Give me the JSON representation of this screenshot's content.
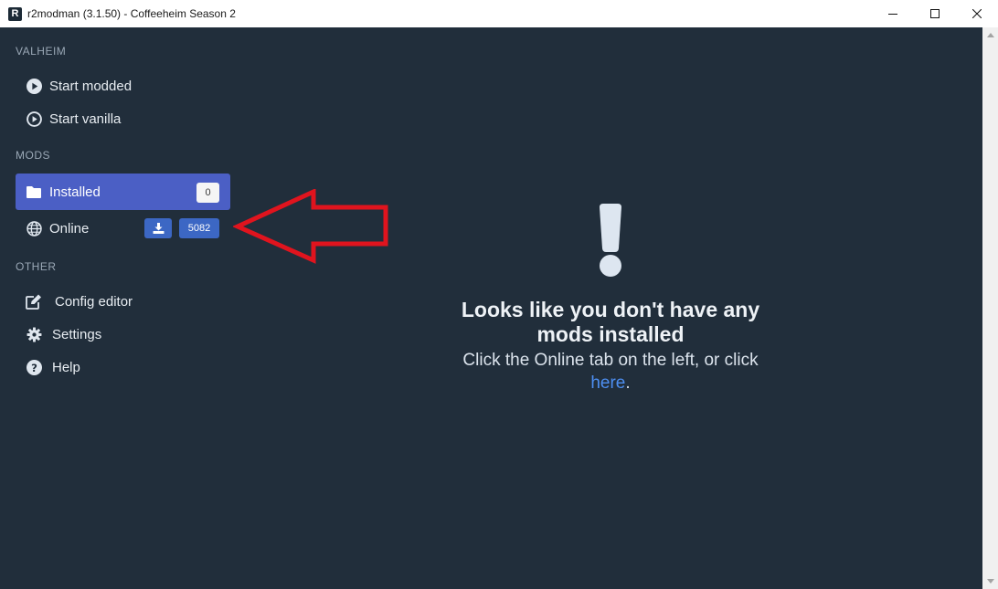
{
  "window": {
    "title": "r2modman (3.1.50) - Coffeeheim Season 2",
    "app_icon_letter": "R"
  },
  "sidebar": {
    "game_section": {
      "label": "VALHEIM",
      "items": [
        {
          "label": "Start modded",
          "icon": "play-circle-icon"
        },
        {
          "label": "Start vanilla",
          "icon": "play-circle-outline-icon"
        }
      ]
    },
    "mods_section": {
      "label": "MODS",
      "installed": {
        "label": "Installed",
        "count": "0",
        "icon": "folder-icon",
        "active": true
      },
      "online": {
        "label": "Online",
        "count": "5082",
        "icon": "globe-icon",
        "download_icon": "download-icon"
      }
    },
    "other_section": {
      "label": "OTHER",
      "items": [
        {
          "label": "Config editor",
          "icon": "edit-icon"
        },
        {
          "label": "Settings",
          "icon": "gear-icon"
        },
        {
          "label": "Help",
          "icon": "question-circle-icon"
        }
      ]
    }
  },
  "main": {
    "empty_title": "Looks like you don't have any mods installed",
    "empty_text": "Click the Online tab on the left, or click",
    "empty_link": "here",
    "empty_suffix": ".",
    "icon": "exclamation-icon"
  },
  "colors": {
    "background": "#212e3b",
    "active_item": "#4b5fc5",
    "badge_blue": "#3c67c4",
    "link": "#4d8ef0",
    "annotation_arrow": "#e0141e"
  }
}
